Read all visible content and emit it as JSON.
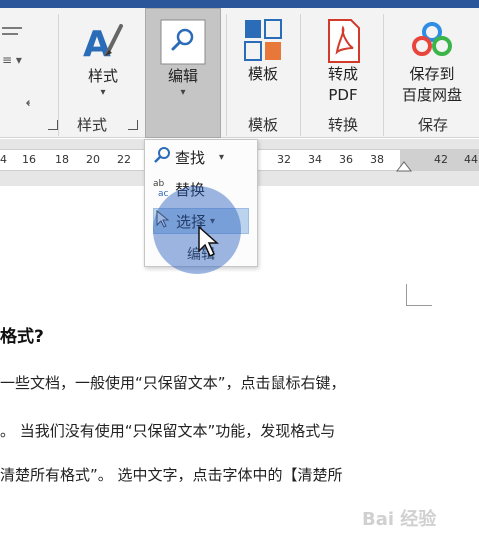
{
  "ribbon": {
    "styles_button": {
      "label": "样式",
      "icon": "styles-brush-icon"
    },
    "editing_button": {
      "label": "编辑",
      "icon": "search-magnifier-icon"
    },
    "templates_button": {
      "label": "模板",
      "icon": "templates-grid-icon"
    },
    "topdf_button": {
      "label_line1": "转成",
      "label_line2": "PDF",
      "icon": "pdf-convert-icon"
    },
    "save_baidu_button": {
      "label_line1": "保存到",
      "label_line2": "百度网盘",
      "icon": "baidu-cloud-icon"
    },
    "groups": {
      "styles": "样式",
      "templates": "模板",
      "convert": "转换",
      "save": "保存"
    }
  },
  "ruler": {
    "numbers": [
      "4",
      "16",
      "18",
      "20",
      "22",
      "32",
      "34",
      "36",
      "38",
      "42",
      "44"
    ]
  },
  "dropdown": {
    "find": "查找",
    "replace": "替换",
    "select": "选择",
    "footer": "编辑"
  },
  "document": {
    "heading": "格式?",
    "lines": [
      "一些文档，一般使用“只保留文本”，点击鼠标右键，",
      "。 当我们没有使用“只保留文本”功能，发现格式与",
      "清楚所有格式”。 选中文字，点击字体中的【清楚所"
    ]
  },
  "watermark": "Bai 经验",
  "colors": {
    "titlebar": "#2b579a",
    "ribbon_bg": "#f3f3f3",
    "editing_pressed": "#c5c5c5",
    "selected_item": "#bcd3ee",
    "highlight": "#285fbe"
  }
}
